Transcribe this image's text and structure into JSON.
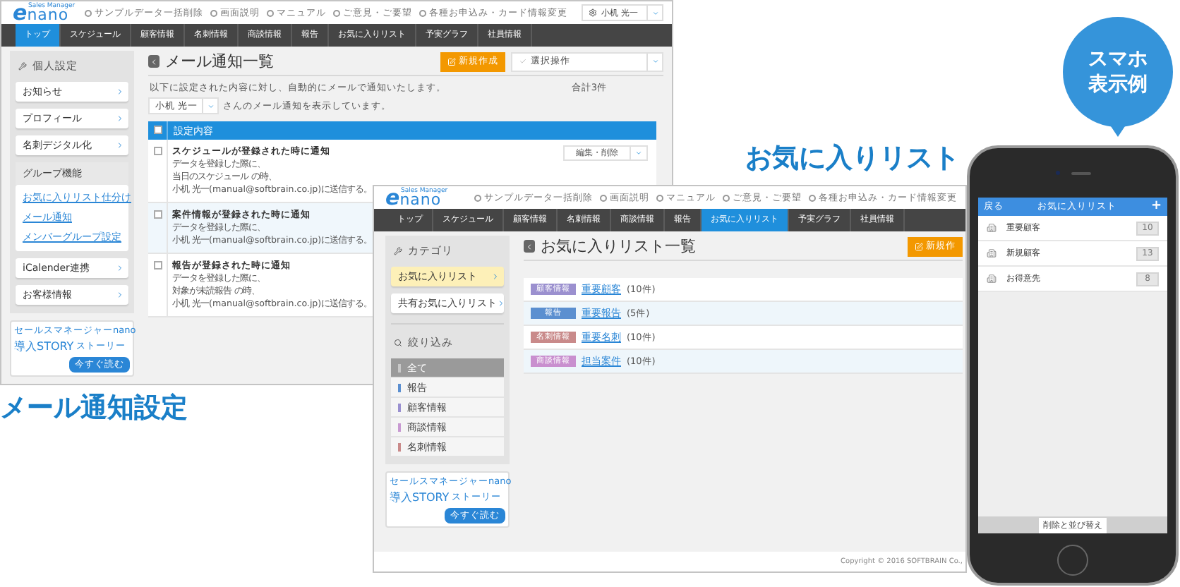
{
  "mail_window": {
    "logo": {
      "tagline": "Sales Manager",
      "mark": "e",
      "name": "nano"
    },
    "top_links": [
      "サンプルデータ一括削除",
      "画面説明",
      "マニュアル",
      "ご意見・ご要望",
      "各種お申込み・カード情報変更"
    ],
    "user": "小机 光一",
    "nav": [
      {
        "label": "トップ",
        "selected": true
      },
      {
        "label": "スケジュール",
        "selected": false
      },
      {
        "label": "顧客情報",
        "selected": false
      },
      {
        "label": "名刺情報",
        "selected": false
      },
      {
        "label": "商談情報",
        "selected": false
      },
      {
        "label": "報告",
        "selected": false
      },
      {
        "label": "お気に入りリスト",
        "selected": false
      },
      {
        "label": "予実グラフ",
        "selected": false
      },
      {
        "label": "社員情報",
        "selected": false
      }
    ],
    "sidebar": {
      "title": "個人設定",
      "items": [
        {
          "kind": "item",
          "label": "お知らせ"
        },
        {
          "kind": "item",
          "label": "プロフィール"
        },
        {
          "kind": "item",
          "label": "名刺デジタル化"
        },
        {
          "kind": "group",
          "label": "グループ機能",
          "links": [
            "お気に入りリスト仕分け",
            "メール通知",
            "メンバーグループ設定"
          ]
        },
        {
          "kind": "item",
          "label": "iCalender連携"
        },
        {
          "kind": "item",
          "label": "お客様情報"
        }
      ]
    },
    "banner": {
      "caption": "セールスマネージャーnano",
      "title": "導入STORY",
      "subtitle": "ストーリー",
      "button": "今すぐ読む"
    },
    "page_title": "メール通知一覧",
    "new_button": "新規作成",
    "bulk_select": "選択操作",
    "description": "以下に設定された内容に対し、自動的にメールで通知いたします。",
    "total": "合計3件",
    "member_select": "小机 光一",
    "member_note": "さんのメール通知を表示しています。",
    "table": {
      "header": "設定内容",
      "header_checked": false,
      "rows": [
        {
          "checked": false,
          "highlighted": false,
          "title": "スケジュールが登録された時に通知",
          "lines": [
            "データを登録した際に、",
            "当日のスケジュール の時、",
            "小机 光一(manual@softbrain.co.jp)に送信する。"
          ],
          "action": "編集・削除"
        },
        {
          "checked": false,
          "highlighted": true,
          "title": "案件情報が登録された時に通知",
          "lines": [
            "データを登録した際に、",
            "小机 光一(manual@softbrain.co.jp)に送信する。"
          ]
        },
        {
          "checked": false,
          "highlighted": false,
          "title": "報告が登録された時に通知",
          "lines": [
            "データを登録した際に、",
            "対象が未読報告 の時、",
            "小机 光一(manual@softbrain.co.jp)に送信する。"
          ]
        }
      ]
    },
    "caption": "メール通知設定"
  },
  "favorites_window": {
    "logo": {
      "tagline": "Sales Manager",
      "mark": "e",
      "name": "nano"
    },
    "top_links": [
      "サンプルデータ一括削除",
      "画面説明",
      "マニュアル",
      "ご意見・ご要望",
      "各種お申込み・カード情報変更"
    ],
    "nav": [
      {
        "label": "トップ",
        "selected": false
      },
      {
        "label": "スケジュール",
        "selected": false
      },
      {
        "label": "顧客情報",
        "selected": false
      },
      {
        "label": "名刺情報",
        "selected": false
      },
      {
        "label": "商談情報",
        "selected": false
      },
      {
        "label": "報告",
        "selected": false
      },
      {
        "label": "お気に入りリスト",
        "selected": true
      },
      {
        "label": "予実グラフ",
        "selected": false
      },
      {
        "label": "社員情報",
        "selected": false
      }
    ],
    "sidebar": {
      "category_title": "カテゴリ",
      "lists": [
        {
          "label": "お気に入りリスト",
          "selected": true
        },
        {
          "label": "共有お気に入りリスト",
          "selected": false
        }
      ],
      "filter_title": "絞り込み",
      "filters": [
        {
          "label": "全て",
          "selected": true,
          "color": "#c8c8c8"
        },
        {
          "label": "報告",
          "selected": false,
          "color": "#5b8fd0"
        },
        {
          "label": "顧客情報",
          "selected": false,
          "color": "#9a90d0"
        },
        {
          "label": "商談情報",
          "selected": false,
          "color": "#c89ad2"
        },
        {
          "label": "名刺情報",
          "selected": false,
          "color": "#c98a8a"
        }
      ]
    },
    "banner": {
      "caption": "セールスマネージャーnano",
      "title": "導入STORY",
      "subtitle": "ストーリー",
      "button": "今すぐ読む"
    },
    "page_title": "お気に入りリスト一覧",
    "new_button": "新規作",
    "entries": [
      {
        "tag": "顧客情報",
        "color": "#9b90cf",
        "link": "重要顧客",
        "count": "(10件)"
      },
      {
        "tag": "報告",
        "color": "#5b8fd0",
        "link": "重要報告",
        "count": "(5件)"
      },
      {
        "tag": "名刺情報",
        "color": "#c98a8a",
        "link": "重要名刺",
        "count": "(10件)"
      },
      {
        "tag": "商談情報",
        "color": "#c98fcf",
        "link": "担当案件",
        "count": "(10件)"
      }
    ],
    "copyright": "Copyright © 2016 SOFTBRAIN Co.,",
    "caption": "お気に入りリスト"
  },
  "bubble": {
    "lines": [
      "スマホ",
      "表示例"
    ]
  },
  "phone": {
    "back": "戻る",
    "title": "お気に入りリスト",
    "add": "+",
    "rows": [
      {
        "label": "重要顧客",
        "count": "10"
      },
      {
        "label": "新規顧客",
        "count": "13"
      },
      {
        "label": "お得意先",
        "count": "8"
      }
    ],
    "footer_button": "削除と並び替え"
  }
}
